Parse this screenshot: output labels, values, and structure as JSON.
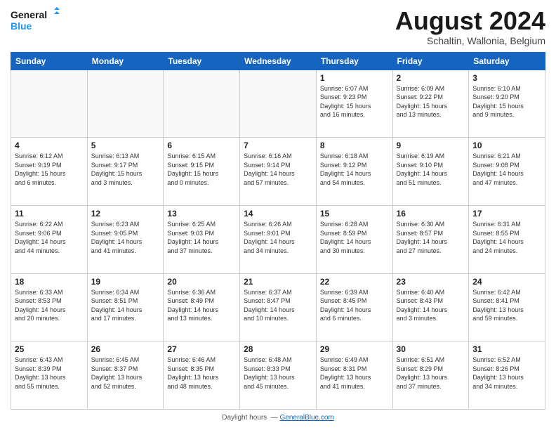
{
  "header": {
    "logo_general": "General",
    "logo_blue": "Blue",
    "month_title": "August 2024",
    "subtitle": "Schaltin, Wallonia, Belgium"
  },
  "calendar": {
    "days_of_week": [
      "Sunday",
      "Monday",
      "Tuesday",
      "Wednesday",
      "Thursday",
      "Friday",
      "Saturday"
    ],
    "weeks": [
      [
        {
          "day": "",
          "info": ""
        },
        {
          "day": "",
          "info": ""
        },
        {
          "day": "",
          "info": ""
        },
        {
          "day": "",
          "info": ""
        },
        {
          "day": "1",
          "info": "Sunrise: 6:07 AM\nSunset: 9:23 PM\nDaylight: 15 hours\nand 16 minutes."
        },
        {
          "day": "2",
          "info": "Sunrise: 6:09 AM\nSunset: 9:22 PM\nDaylight: 15 hours\nand 13 minutes."
        },
        {
          "day": "3",
          "info": "Sunrise: 6:10 AM\nSunset: 9:20 PM\nDaylight: 15 hours\nand 9 minutes."
        }
      ],
      [
        {
          "day": "4",
          "info": "Sunrise: 6:12 AM\nSunset: 9:19 PM\nDaylight: 15 hours\nand 6 minutes."
        },
        {
          "day": "5",
          "info": "Sunrise: 6:13 AM\nSunset: 9:17 PM\nDaylight: 15 hours\nand 3 minutes."
        },
        {
          "day": "6",
          "info": "Sunrise: 6:15 AM\nSunset: 9:15 PM\nDaylight: 15 hours\nand 0 minutes."
        },
        {
          "day": "7",
          "info": "Sunrise: 6:16 AM\nSunset: 9:14 PM\nDaylight: 14 hours\nand 57 minutes."
        },
        {
          "day": "8",
          "info": "Sunrise: 6:18 AM\nSunset: 9:12 PM\nDaylight: 14 hours\nand 54 minutes."
        },
        {
          "day": "9",
          "info": "Sunrise: 6:19 AM\nSunset: 9:10 PM\nDaylight: 14 hours\nand 51 minutes."
        },
        {
          "day": "10",
          "info": "Sunrise: 6:21 AM\nSunset: 9:08 PM\nDaylight: 14 hours\nand 47 minutes."
        }
      ],
      [
        {
          "day": "11",
          "info": "Sunrise: 6:22 AM\nSunset: 9:06 PM\nDaylight: 14 hours\nand 44 minutes."
        },
        {
          "day": "12",
          "info": "Sunrise: 6:23 AM\nSunset: 9:05 PM\nDaylight: 14 hours\nand 41 minutes."
        },
        {
          "day": "13",
          "info": "Sunrise: 6:25 AM\nSunset: 9:03 PM\nDaylight: 14 hours\nand 37 minutes."
        },
        {
          "day": "14",
          "info": "Sunrise: 6:26 AM\nSunset: 9:01 PM\nDaylight: 14 hours\nand 34 minutes."
        },
        {
          "day": "15",
          "info": "Sunrise: 6:28 AM\nSunset: 8:59 PM\nDaylight: 14 hours\nand 30 minutes."
        },
        {
          "day": "16",
          "info": "Sunrise: 6:30 AM\nSunset: 8:57 PM\nDaylight: 14 hours\nand 27 minutes."
        },
        {
          "day": "17",
          "info": "Sunrise: 6:31 AM\nSunset: 8:55 PM\nDaylight: 14 hours\nand 24 minutes."
        }
      ],
      [
        {
          "day": "18",
          "info": "Sunrise: 6:33 AM\nSunset: 8:53 PM\nDaylight: 14 hours\nand 20 minutes."
        },
        {
          "day": "19",
          "info": "Sunrise: 6:34 AM\nSunset: 8:51 PM\nDaylight: 14 hours\nand 17 minutes."
        },
        {
          "day": "20",
          "info": "Sunrise: 6:36 AM\nSunset: 8:49 PM\nDaylight: 14 hours\nand 13 minutes."
        },
        {
          "day": "21",
          "info": "Sunrise: 6:37 AM\nSunset: 8:47 PM\nDaylight: 14 hours\nand 10 minutes."
        },
        {
          "day": "22",
          "info": "Sunrise: 6:39 AM\nSunset: 8:45 PM\nDaylight: 14 hours\nand 6 minutes."
        },
        {
          "day": "23",
          "info": "Sunrise: 6:40 AM\nSunset: 8:43 PM\nDaylight: 14 hours\nand 3 minutes."
        },
        {
          "day": "24",
          "info": "Sunrise: 6:42 AM\nSunset: 8:41 PM\nDaylight: 13 hours\nand 59 minutes."
        }
      ],
      [
        {
          "day": "25",
          "info": "Sunrise: 6:43 AM\nSunset: 8:39 PM\nDaylight: 13 hours\nand 55 minutes."
        },
        {
          "day": "26",
          "info": "Sunrise: 6:45 AM\nSunset: 8:37 PM\nDaylight: 13 hours\nand 52 minutes."
        },
        {
          "day": "27",
          "info": "Sunrise: 6:46 AM\nSunset: 8:35 PM\nDaylight: 13 hours\nand 48 minutes."
        },
        {
          "day": "28",
          "info": "Sunrise: 6:48 AM\nSunset: 8:33 PM\nDaylight: 13 hours\nand 45 minutes."
        },
        {
          "day": "29",
          "info": "Sunrise: 6:49 AM\nSunset: 8:31 PM\nDaylight: 13 hours\nand 41 minutes."
        },
        {
          "day": "30",
          "info": "Sunrise: 6:51 AM\nSunset: 8:29 PM\nDaylight: 13 hours\nand 37 minutes."
        },
        {
          "day": "31",
          "info": "Sunrise: 6:52 AM\nSunset: 8:26 PM\nDaylight: 13 hours\nand 34 minutes."
        }
      ]
    ]
  },
  "footer": {
    "text": "Daylight hours"
  }
}
